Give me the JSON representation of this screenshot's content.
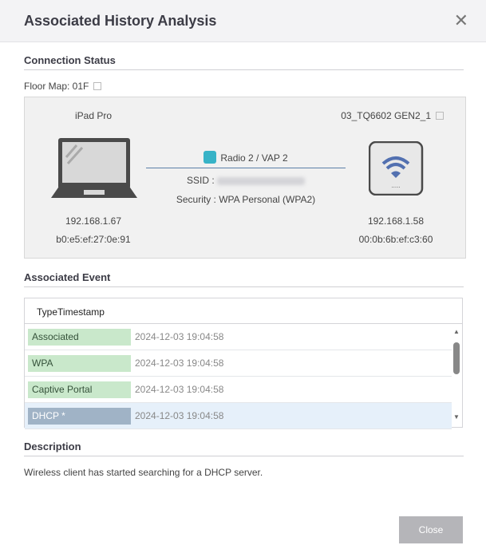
{
  "title": "Associated History Analysis",
  "connection": {
    "heading": "Connection Status",
    "floor_map": "Floor Map: 01F",
    "client": {
      "name": "iPad Pro",
      "ip": "192.168.1.67",
      "mac": "b0:e5:ef:27:0e:91"
    },
    "ap": {
      "name": "03_TQ6602 GEN2_1",
      "ip": "192.168.1.58",
      "mac": "00:0b:6b:ef:c3:60"
    },
    "radio": "Radio 2 / VAP 2",
    "ssid_label": "SSID :",
    "security": "Security : WPA Personal (WPA2)"
  },
  "events": {
    "heading": "Associated Event",
    "header": "TypeTimestamp",
    "rows": [
      {
        "type": "Associated",
        "timestamp": "2024-12-03 19:04:58"
      },
      {
        "type": "WPA",
        "timestamp": "2024-12-03 19:04:58"
      },
      {
        "type": "Captive Portal",
        "timestamp": "2024-12-03 19:04:58"
      },
      {
        "type": "DHCP *",
        "timestamp": "2024-12-03 19:04:58"
      }
    ]
  },
  "description": {
    "heading": "Description",
    "text": "Wireless client has started searching for a DHCP server."
  },
  "close_button": "Close"
}
